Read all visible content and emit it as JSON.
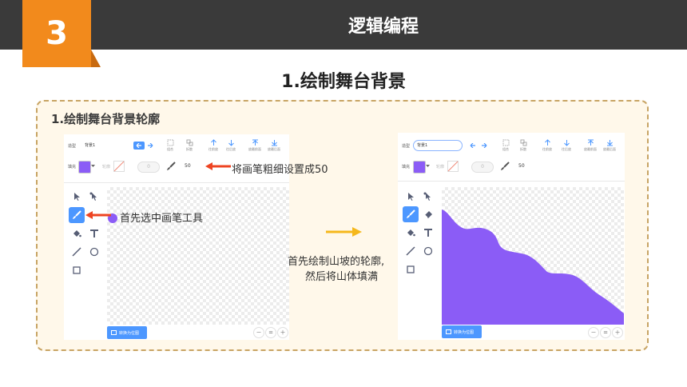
{
  "header": {
    "badge_number": "3",
    "title": "逻辑编程"
  },
  "section": {
    "title": "1.绘制舞台背景"
  },
  "panel": {
    "title": "1.绘制舞台背景轮廓"
  },
  "editor": {
    "costume_label": "造型",
    "costume_name": "背景1",
    "group_label": "组合",
    "ungroup_label": "拆散",
    "forward_label": "往前放",
    "backward_label": "往后放",
    "front_label": "放最前面",
    "back_label": "放最后面",
    "fill_label": "填充",
    "outline_label": "轮廓",
    "outline_value": "0",
    "brush_size": "50",
    "convert_label": "转换为位图",
    "zoom_out": "－",
    "zoom_reset": "=",
    "zoom_in": "＋",
    "fill_color": "#8b5cf6"
  },
  "annotations": {
    "brush_size_note": "将画笔粗细设置成50",
    "select_brush_note": "首先选中画笔工具",
    "process_line1": "首先绘制山坡的轮廓,",
    "process_line2": "然后将山体填满"
  },
  "colors": {
    "accent_orange": "#f28a1c",
    "arrow_red": "#ee4422",
    "arrow_yellow": "#f5b81c",
    "mountain": "#8b5cf6",
    "brand_blue": "#4c97ff"
  }
}
